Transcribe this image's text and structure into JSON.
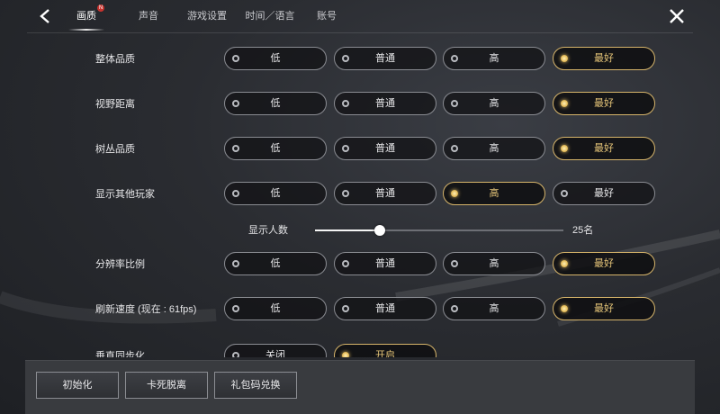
{
  "colors": {
    "accent_gold": "#d6b46a",
    "selected_text": "#e6c578",
    "badge_red": "#c8332e",
    "background": "#2a2c31"
  },
  "nav": {
    "back_icon": "chevron-left-icon",
    "close_icon": "close-x-icon",
    "tabs": [
      {
        "label": "画质",
        "active": true,
        "badge": "N"
      },
      {
        "label": "声音",
        "active": false
      },
      {
        "label": "游戏设置",
        "active": false
      },
      {
        "label": "时间／语言",
        "active": false
      },
      {
        "label": "账号",
        "active": false
      }
    ]
  },
  "settings": {
    "overall_quality": {
      "label": "整体品质",
      "options": [
        "低",
        "普通",
        "高",
        "最好"
      ],
      "selected": "最好"
    },
    "view_distance": {
      "label": "视野距离",
      "options": [
        "低",
        "普通",
        "高",
        "最好"
      ],
      "selected": "最好"
    },
    "foliage_quality": {
      "label": "树丛品质",
      "options": [
        "低",
        "普通",
        "高",
        "最好"
      ],
      "selected": "最好"
    },
    "show_other_players": {
      "label": "显示其他玩家",
      "options": [
        "低",
        "普通",
        "高",
        "最好"
      ],
      "selected": "高"
    },
    "player_count": {
      "label": "显示人数",
      "value": "25名",
      "fraction": 0.26
    },
    "resolution_scale": {
      "label": "分辨率比例",
      "options": [
        "低",
        "普通",
        "高",
        "最好"
      ],
      "selected": "最好"
    },
    "refresh_rate": {
      "label": "刷新速度 (现在 : 61fps)",
      "options": [
        "低",
        "普通",
        "高",
        "最好"
      ],
      "selected": "最好"
    },
    "vsync": {
      "label": "垂直同步化",
      "options": [
        "关闭",
        "开启"
      ],
      "selected": "开启"
    }
  },
  "bottom": {
    "reset": "初始化",
    "unstuck": "卡死脱离",
    "gift_code": "礼包码兑换"
  }
}
